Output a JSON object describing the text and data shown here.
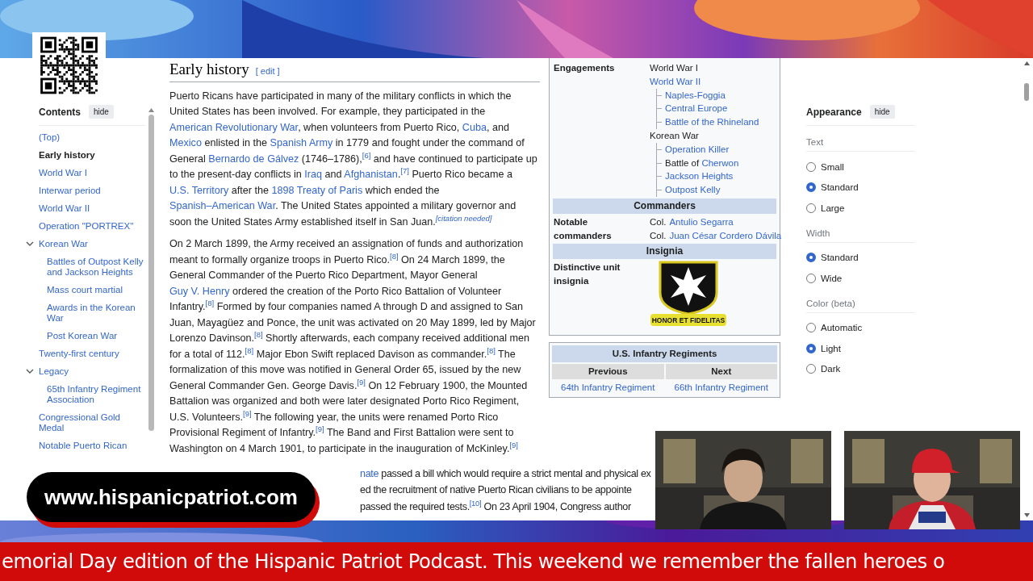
{
  "toc": {
    "title": "Contents",
    "hide_button": "hide",
    "items": [
      {
        "label": "(Top)",
        "selected": false
      },
      {
        "label": "Early history",
        "selected": true
      },
      {
        "label": "World War I",
        "selected": false
      },
      {
        "label": "Interwar period",
        "selected": false
      },
      {
        "label": "World War II",
        "selected": false
      },
      {
        "label": "Operation \"PORTREX\"",
        "selected": false
      },
      {
        "label": "Korean War",
        "selected": false,
        "expanded": true,
        "children": [
          {
            "label": "Battles of Outpost Kelly and Jackson Heights",
            "selected": false
          },
          {
            "label": "Mass court martial",
            "selected": false
          },
          {
            "label": "Awards in the Korean War",
            "selected": false
          },
          {
            "label": "Post Korean War",
            "selected": false
          }
        ]
      },
      {
        "label": "Twenty-first century",
        "selected": false
      },
      {
        "label": "Legacy",
        "selected": false,
        "expanded": true,
        "children": [
          {
            "label": "65th Infantry Regiment Association",
            "selected": false
          }
        ]
      },
      {
        "label": "Congressional Gold Medal",
        "selected": false
      },
      {
        "label": "Notable Puerto Rican",
        "selected": false
      }
    ]
  },
  "article": {
    "heading": "Early history",
    "edit_link": "[ edit ]",
    "paragraphs": [
      [
        {
          "text": "Puerto Ricans have participated in many of the military conflicts in which the United States has been involved. For example, they participated in the ",
          "kind": "text"
        },
        {
          "text": "American Revolutionary War",
          "kind": "link"
        },
        {
          "text": ", when volunteers from Puerto Rico, ",
          "kind": "text"
        },
        {
          "text": "Cuba",
          "kind": "link"
        },
        {
          "text": ", and ",
          "kind": "text"
        },
        {
          "text": "Mexico",
          "kind": "link"
        },
        {
          "text": " enlisted in the ",
          "kind": "text"
        },
        {
          "text": "Spanish Army",
          "kind": "link"
        },
        {
          "text": " in 1779 and fought under the command of General ",
          "kind": "text"
        },
        {
          "text": "Bernardo de Gálvez",
          "kind": "link"
        },
        {
          "text": " (1746–1786),",
          "kind": "text"
        },
        {
          "text": "[6]",
          "kind": "ref"
        },
        {
          "text": " and have continued to participate up to the present-day conflicts in ",
          "kind": "text"
        },
        {
          "text": "Iraq",
          "kind": "link"
        },
        {
          "text": " and ",
          "kind": "text"
        },
        {
          "text": "Afghanistan",
          "kind": "link"
        },
        {
          "text": ".",
          "kind": "text"
        },
        {
          "text": "[7]",
          "kind": "ref"
        },
        {
          "text": " Puerto Rico became a ",
          "kind": "text"
        },
        {
          "text": "U.S. Territory",
          "kind": "link"
        },
        {
          "text": " after the ",
          "kind": "text"
        },
        {
          "text": "1898 Treaty of Paris",
          "kind": "link"
        },
        {
          "text": " which ended the ",
          "kind": "text"
        },
        {
          "text": "Spanish–American War",
          "kind": "link"
        },
        {
          "text": ". The United States appointed a military governor and soon the United States Army established itself in San Juan.",
          "kind": "text"
        },
        {
          "text": "[citation needed]",
          "kind": "note"
        }
      ],
      [
        {
          "text": "On 2 March 1899, the Army received an assignation of funds and authorization meant to formally organize troops in Puerto Rico.",
          "kind": "text"
        },
        {
          "text": "[8]",
          "kind": "ref"
        },
        {
          "text": " On 24 March 1899, the General Commander of the Puerto Rico Department, Mayor General ",
          "kind": "text"
        },
        {
          "text": "Guy V. Henry",
          "kind": "link"
        },
        {
          "text": " ordered the creation of the Porto Rico Battalion of Volunteer Infantry.",
          "kind": "text"
        },
        {
          "text": "[8]",
          "kind": "ref"
        },
        {
          "text": " Formed by four companies named A through D and assigned to San Juan, Mayagüez and Ponce, the unit was activated on 20 May 1899, led by Major Lorenzo Davinson.",
          "kind": "text"
        },
        {
          "text": "[8]",
          "kind": "ref"
        },
        {
          "text": " Shortly afterwards, each company received additional men for a total of 112.",
          "kind": "text"
        },
        {
          "text": "[8]",
          "kind": "ref"
        },
        {
          "text": " Major Ebon Swift replaced Davison as commander.",
          "kind": "text"
        },
        {
          "text": "[8]",
          "kind": "ref"
        },
        {
          "text": " The formalization of this move was notified in General Order 65, issued by the new General Commander Gen. George Davis.",
          "kind": "text"
        },
        {
          "text": "[9]",
          "kind": "ref"
        },
        {
          "text": " On 12 February 1900, the Mounted Battalion was organized and both were later designated Porto Rico Regiment, U.S. Volunteers.",
          "kind": "text"
        },
        {
          "text": "[9]",
          "kind": "ref"
        },
        {
          "text": " The following year, the units were renamed Porto Rico Provisional Regiment of Infantry.",
          "kind": "text"
        },
        {
          "text": "[9]",
          "kind": "ref"
        },
        {
          "text": " The Band and First Battalion were sent to Washington on 4 March 1901, to participate in the inauguration of McKinley.",
          "kind": "text"
        },
        {
          "text": "[9]",
          "kind": "ref"
        }
      ]
    ],
    "partial_lines": [
      [
        {
          "text": "nate",
          "kind": "link"
        },
        {
          "text": " passed a bill which would require a strict mental and physical ex",
          "kind": "text"
        }
      ],
      [
        {
          "text": "ed the recruitment of native Puerto Rican civilians to be appointe",
          "kind": "text"
        }
      ],
      [
        {
          "text": "passed the required tests.",
          "kind": "text"
        },
        {
          "text": "[10]",
          "kind": "ref"
        },
        {
          "text": " On 23 April 1904, Congress author",
          "kind": "text"
        }
      ]
    ]
  },
  "infobox": {
    "engagements": {
      "label": "Engagements",
      "items": [
        {
          "parts": [
            {
              "text": "World War I",
              "kind": "text"
            }
          ]
        },
        {
          "parts": [
            {
              "text": "World War II",
              "kind": "link"
            }
          ],
          "children": [
            {
              "parts": [
                {
                  "text": "Naples-Foggia",
                  "kind": "link"
                }
              ]
            },
            {
              "parts": [
                {
                  "text": "Central Europe",
                  "kind": "link"
                }
              ]
            },
            {
              "parts": [
                {
                  "text": "Battle of the Rhineland",
                  "kind": "link"
                }
              ]
            }
          ]
        },
        {
          "parts": [
            {
              "text": "Korean War",
              "kind": "text"
            }
          ],
          "children": [
            {
              "parts": [
                {
                  "text": "Operation Killer",
                  "kind": "link"
                }
              ]
            },
            {
              "parts": [
                {
                  "text": "Battle of ",
                  "kind": "text"
                },
                {
                  "text": "Cherwon",
                  "kind": "link"
                }
              ]
            },
            {
              "parts": [
                {
                  "text": "Jackson Heights",
                  "kind": "link"
                }
              ]
            },
            {
              "parts": [
                {
                  "text": "Outpost Kelly",
                  "kind": "link"
                }
              ]
            }
          ]
        }
      ]
    },
    "commanders": {
      "header": "Commanders",
      "label": "Notable commanders",
      "items": [
        {
          "parts": [
            {
              "text": "Col.",
              "kind": "text"
            },
            {
              "text": "Antulio Segarra",
              "kind": "link"
            }
          ]
        },
        {
          "parts": [
            {
              "text": "Col.",
              "kind": "text"
            },
            {
              "text": "Juan César Cordero Dávila",
              "kind": "link"
            }
          ]
        }
      ]
    },
    "insignia": {
      "header": "Insignia",
      "label": "Distinctive unit insignia",
      "motto": "HONOR ET FIDELITAS"
    }
  },
  "navbox": {
    "title": "U.S. Infantry Regiments",
    "previous_label": "Previous",
    "next_label": "Next",
    "previous": "64th Infantry Regiment",
    "next": "66th Infantry Regiment"
  },
  "appearance": {
    "title": "Appearance",
    "hide_button": "hide",
    "groups": [
      {
        "label": "Text",
        "options": [
          {
            "label": "Small",
            "selected": false
          },
          {
            "label": "Standard",
            "selected": true
          },
          {
            "label": "Large",
            "selected": false
          }
        ]
      },
      {
        "label": "Width",
        "options": [
          {
            "label": "Standard",
            "selected": true
          },
          {
            "label": "Wide",
            "selected": false
          }
        ]
      },
      {
        "label": "Color (beta)",
        "options": [
          {
            "label": "Automatic",
            "selected": false
          },
          {
            "label": "Light",
            "selected": true
          },
          {
            "label": "Dark",
            "selected": false
          }
        ]
      }
    ]
  },
  "url_banner": "www.hispanicpatriot.com",
  "ticker": "emorial Day edition of the Hispanic Patriot Podcast. This weekend we remember the fallen heroes o"
}
